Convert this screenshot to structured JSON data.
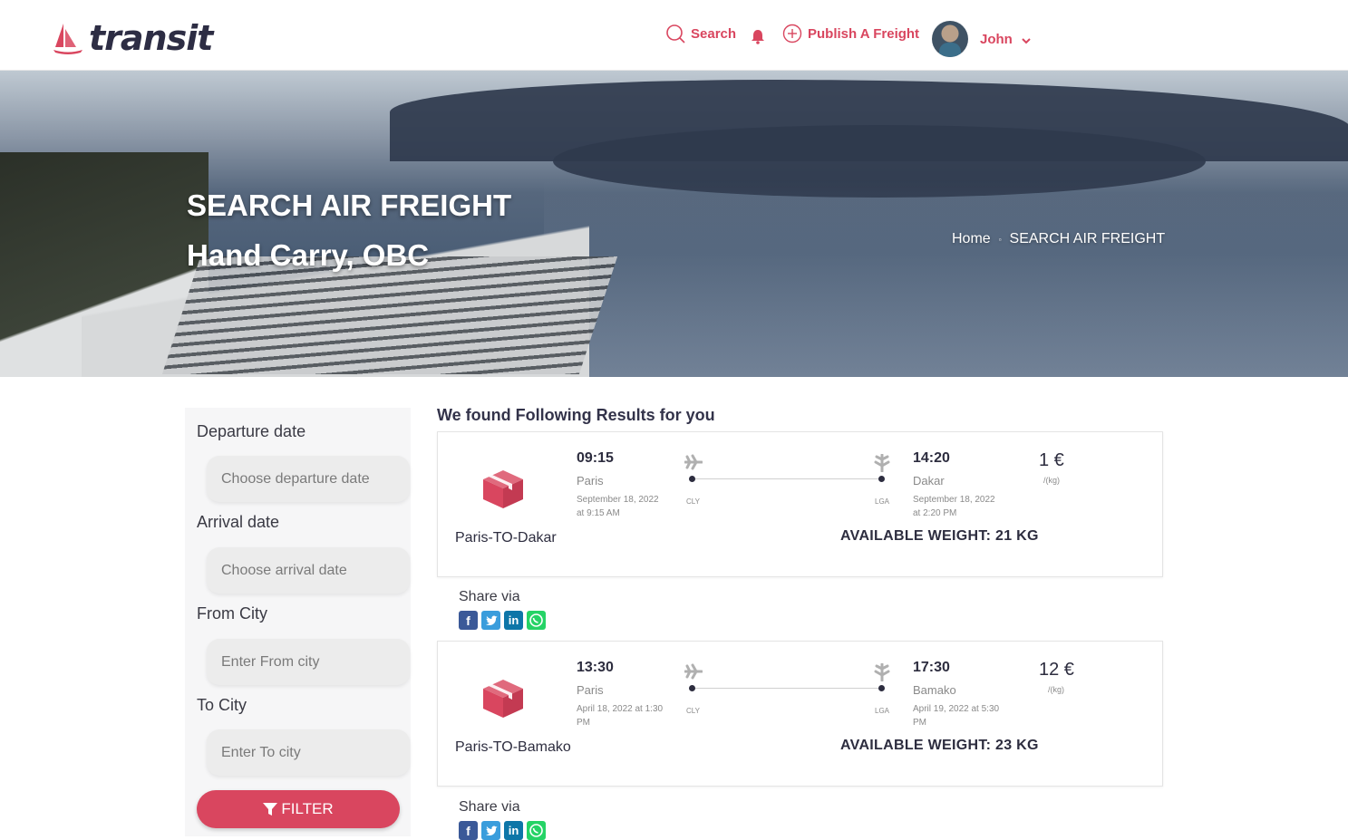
{
  "brand": {
    "name": "transit",
    "accent": "#d9465f"
  },
  "nav": {
    "search_label": "Search",
    "publish_label": "Publish A Freight",
    "user_name": "John"
  },
  "hero": {
    "title": "SEARCH AIR FREIGHT",
    "subtitle": "Hand Carry, OBC",
    "breadcrumb": {
      "home": "Home",
      "current": "SEARCH AIR FREIGHT"
    }
  },
  "filter": {
    "departure_label": "Departure date",
    "departure_placeholder": "Choose departure date",
    "arrival_label": "Arrival date",
    "arrival_placeholder": "Choose arrival date",
    "from_label": "From City",
    "from_placeholder": "Enter From city",
    "to_label": "To City",
    "to_placeholder": "Enter To city",
    "button_label": "FILTER"
  },
  "results": {
    "title": "We found Following Results for you",
    "share_label": "Share via",
    "items": [
      {
        "route": "Paris-TO-Dakar",
        "dep_time": "09:15",
        "dep_city": "Paris",
        "dep_date": "September 18, 2022 at 9:15 AM",
        "dep_code": "CLY",
        "arr_time": "14:20",
        "arr_city": "Dakar",
        "arr_date": "September 18, 2022 at 2:20 PM",
        "arr_code": "LGA",
        "price": "1 €",
        "unit": "/(kg)",
        "weight": "AVAILABLE WEIGHT: 21 KG"
      },
      {
        "route": "Paris-TO-Bamako",
        "dep_time": "13:30",
        "dep_city": "Paris",
        "dep_date": "April 18, 2022 at 1:30 PM",
        "dep_code": "CLY",
        "arr_time": "17:30",
        "arr_city": "Bamako",
        "arr_date": "April 19, 2022 at 5:30 PM",
        "arr_code": "LGA",
        "price": "12 €",
        "unit": "/(kg)",
        "weight": "AVAILABLE WEIGHT: 23 KG"
      }
    ]
  }
}
